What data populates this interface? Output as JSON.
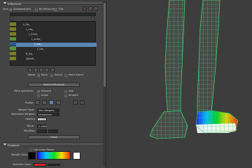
{
  "window": {
    "title": "Influences"
  },
  "sections": {
    "influences": "Influences",
    "gradient": "Gradient"
  },
  "topbar": {
    "sort_label": "Sort:",
    "alpha_label": "Alphabetically",
    "hierarchy_label": "By Hierarchy",
    "flat_label": "Flat"
  },
  "tree": {
    "items": [
      {
        "label": "L_hip_",
        "depth": 0
      },
      {
        "label": "L_Leg_",
        "depth": 1
      },
      {
        "label": "L_Knee_",
        "depth": 2
      },
      {
        "label": "L_ankle_",
        "depth": 3
      },
      {
        "label": "L_toe_",
        "depth": 4,
        "selected": true
      },
      {
        "label": "L_toe_",
        "depth": 5
      },
      {
        "label": "R_hip_",
        "depth": 0
      },
      {
        "label": "Spine0_",
        "depth": 0
      }
    ]
  },
  "options": {
    "mode_label": "Mode:",
    "mode_value": "Paint",
    "select_label": "Select",
    "paint_select_label": "Paint Select",
    "select_influences_button": "Select Influences",
    "paint_operation_label": "Paint operation:",
    "replace_label": "Replace",
    "add_label": "Add",
    "scale_label": "Scale",
    "smooth_label": "Smooth",
    "profile_label": "Profile:",
    "weight_type_label": "Weight Type:",
    "weight_type_value": "Skin Weights",
    "normalize_label": "Normalize Weights:",
    "normalize_value": "Interactive",
    "opacity_label": "Opacity:",
    "opacity_value": "1.0000",
    "value_label": "Value:",
    "value_value": "0.0000",
    "min_max_label": "Min/Max:",
    "flood_button": "Flood"
  },
  "gradient": {
    "use_color_ramp_label": "Use Color Ramp",
    "weight_color_label": "Weight Color:",
    "selected_color_label": "Selected Color:",
    "ramp_colors": [
      "#1d1dff",
      "#00c8ff",
      "#00e020",
      "#ffe000",
      "#ff2a00"
    ]
  },
  "viewport": {
    "bg": "#3d3d3d",
    "wire": "#3bd36a"
  }
}
